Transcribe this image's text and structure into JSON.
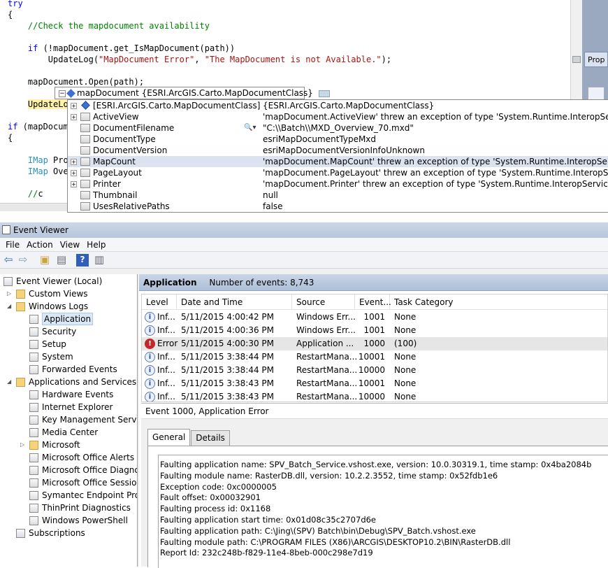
{
  "editor": {
    "code": {
      "l0": "try",
      "l1": "{",
      "l2": "//Check the mapdocument availability",
      "l4a": "if",
      "l4b": " (!mapDocument.get_IsMapDocument(path))",
      "l5a": "UpdateLog(",
      "l5b": "\"MapDocument Error\"",
      "l5c": ", ",
      "l5d": "\"The MapDocument is not Available.\"",
      "l5e": ");",
      "l7": "mapDocument.Open(path);",
      "l9": "UpdateLo",
      "l10a": "if",
      "l10b": " (mapDocum",
      "l11": "{",
      "l13a": "IMap",
      "l13b": " Pro",
      "l14a": "IMap",
      "l14b": " Ove",
      "l16": "//",
      "l16b": "c"
    },
    "datatip": {
      "header_name": "mapDocument",
      "header_value": "{ESRI.ArcGIS.Carto.MapDocumentClass}",
      "rows": [
        {
          "name": "[ESRI.ArcGIS.Carto.MapDocumentClass]",
          "value": "{ESRI.ArcGIS.Carto.MapDocumentClass}"
        },
        {
          "name": "ActiveView",
          "value": "'mapDocument.ActiveView' threw an exception of type 'System.Runtime.InteropServices.COM"
        },
        {
          "name": "DocumentFilename",
          "value": "\"C:\\\\Batch\\\\MXD_Overview_70.mxd\""
        },
        {
          "name": "DocumentType",
          "value": "esriMapDocumentTypeMxd"
        },
        {
          "name": "DocumentVersion",
          "value": "esriMapDocumentVersionInfoUnknown"
        },
        {
          "name": "MapCount",
          "value": "'mapDocument.MapCount' threw an exception of type 'System.Runtime.InteropServices.COM"
        },
        {
          "name": "PageLayout",
          "value": "'mapDocument.PageLayout' threw an exception of type 'System.Runtime.InteropServices.CO"
        },
        {
          "name": "Printer",
          "value": "'mapDocument.Printer' threw an exception of type 'System.Runtime.InteropServices.COMExc"
        },
        {
          "name": "Thumbnail",
          "value": "null"
        },
        {
          "name": "UsesRelativePaths",
          "value": "false"
        }
      ]
    },
    "properties_tab": "Prop"
  },
  "eventviewer": {
    "title": "Event Viewer",
    "menu": [
      "File",
      "Action",
      "View",
      "Help"
    ],
    "tree": {
      "root": "Event Viewer (Local)",
      "custom_views": "Custom Views",
      "windows_logs": "Windows Logs",
      "windows_items": [
        "Application",
        "Security",
        "Setup",
        "System",
        "Forwarded Events"
      ],
      "apps_services": "Applications and Services Lo",
      "apps_items": [
        "Hardware Events",
        "Internet Explorer",
        "Key Management Service",
        "Media Center",
        "Microsoft",
        "Microsoft Office Alerts",
        "Microsoft Office Diagnos",
        "Microsoft Office Sessions",
        "Symantec Endpoint Prote",
        "ThinPrint Diagnostics",
        "Windows PowerShell"
      ],
      "subscriptions": "Subscriptions"
    },
    "header": {
      "title": "Application",
      "count": "Number of events: 8,743"
    },
    "columns": [
      "Level",
      "Date and Time",
      "Source",
      "Event...",
      "Task Category"
    ],
    "events": [
      {
        "level": "Inf...",
        "type": "info",
        "date": "5/11/2015 4:00:42 PM",
        "source": "Windows Err...",
        "id": "1001",
        "task": "None"
      },
      {
        "level": "Inf...",
        "type": "info",
        "date": "5/11/2015 4:00:36 PM",
        "source": "Windows Err...",
        "id": "1001",
        "task": "None"
      },
      {
        "level": "Error",
        "type": "error",
        "date": "5/11/2015 4:00:30 PM",
        "source": "Application ...",
        "id": "1000",
        "task": "(100)"
      },
      {
        "level": "Inf...",
        "type": "info",
        "date": "5/11/2015 3:38:44 PM",
        "source": "RestartMana...",
        "id": "10001",
        "task": "None"
      },
      {
        "level": "Inf...",
        "type": "info",
        "date": "5/11/2015 3:38:44 PM",
        "source": "RestartMana...",
        "id": "10000",
        "task": "None"
      },
      {
        "level": "Inf...",
        "type": "info",
        "date": "5/11/2015 3:38:43 PM",
        "source": "RestartMana...",
        "id": "10001",
        "task": "None"
      },
      {
        "level": "Inf...",
        "type": "info",
        "date": "5/11/2015 3:38:43 PM",
        "source": "RestartMana...",
        "id": "10000",
        "task": "None"
      }
    ],
    "detail": {
      "title": "Event 1000, Application Error",
      "tabs": [
        "General",
        "Details"
      ],
      "lines": [
        "Faulting application name: SPV_Batch_Service.vshost.exe, version: 10.0.30319.1, time stamp: 0x4ba2084b",
        "Faulting module name: RasterDB.dll, version: 10.2.2.3552, time stamp: 0x52fdb1e6",
        "Exception code: 0xc0000005",
        "Fault offset: 0x00032901",
        "Faulting process id: 0x1168",
        "Faulting application start time: 0x01d08c35c2707d6e",
        "Faulting application path: C:\\Jing\\(SPV) Batch\\bin\\Debug\\SPV_Batch.vshost.exe",
        "Faulting module path: C:\\PROGRAM FILES (X86)\\ARCGIS\\DESKTOP10.2\\BIN\\RasterDB.dll",
        "Report Id: 232c248b-f829-11e4-8beb-000c298e7d19"
      ]
    }
  }
}
